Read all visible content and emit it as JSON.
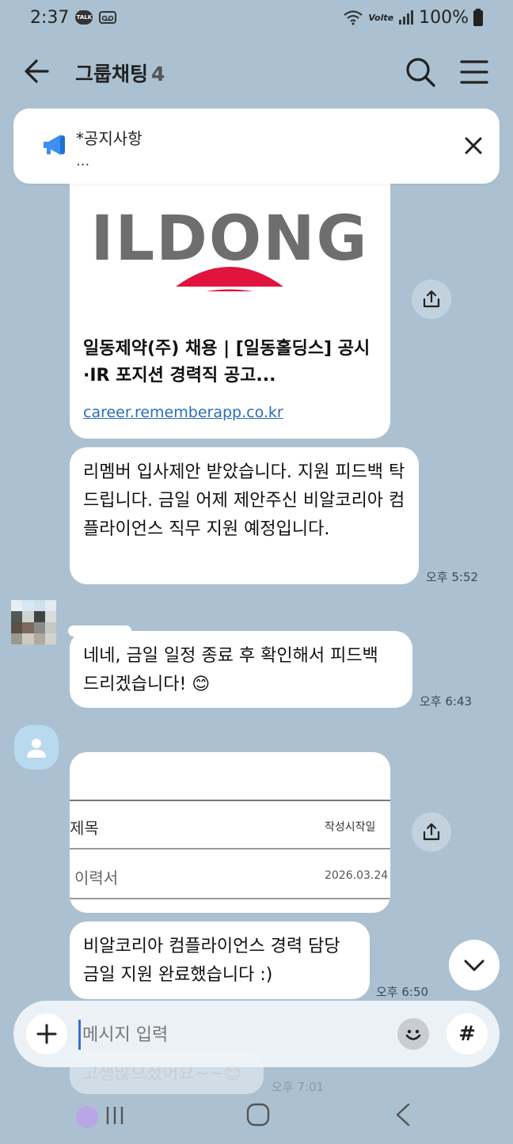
{
  "status_bar": {
    "time": "2:37",
    "talk_badge": "TALK",
    "network": "Volte",
    "battery": "100%"
  },
  "header": {
    "title": "그룹채팅",
    "member_count": "4"
  },
  "notice": {
    "title": "*공지사항",
    "preview": "..."
  },
  "link_card": {
    "logo_text": "ILDONG",
    "title": "일동제약(주) 채용 | [일동홀딩스] 공시·IR 포지션 경력직 공고...",
    "url": "career.rememberapp.co.kr"
  },
  "messages": [
    {
      "text": "리멤버 입사제안 받았습니다. 지원 피드백 탁드립니다. 금일 어제 제안주신 비알코리아 컴플라이언스 직무 지원 예정입니다.",
      "time": "오후 5:52"
    },
    {
      "text": "네네, 금일 일정 종료 후 확인해서 피드백 드리겠습니다! 😊",
      "time": "오후 6:43"
    },
    {
      "text": "비알코리아 컴플라이언스 경력 담당 금일 지원 완료했습니다 :)",
      "time": "오후 6:50"
    },
    {
      "text": "고생많으셨어요~~😊",
      "time": "오후 7:01"
    }
  ],
  "doc_card": {
    "col_title": "제목",
    "col_date": "작성시작일",
    "row_title": "이력서",
    "row_date": "2026.03.24"
  },
  "input_bar": {
    "placeholder": "메시지 입력",
    "hash": "#"
  },
  "colors": {
    "chat_background": "#abc1d1",
    "ildong_red": "#e0143c",
    "link_blue": "#2a6eb8"
  }
}
